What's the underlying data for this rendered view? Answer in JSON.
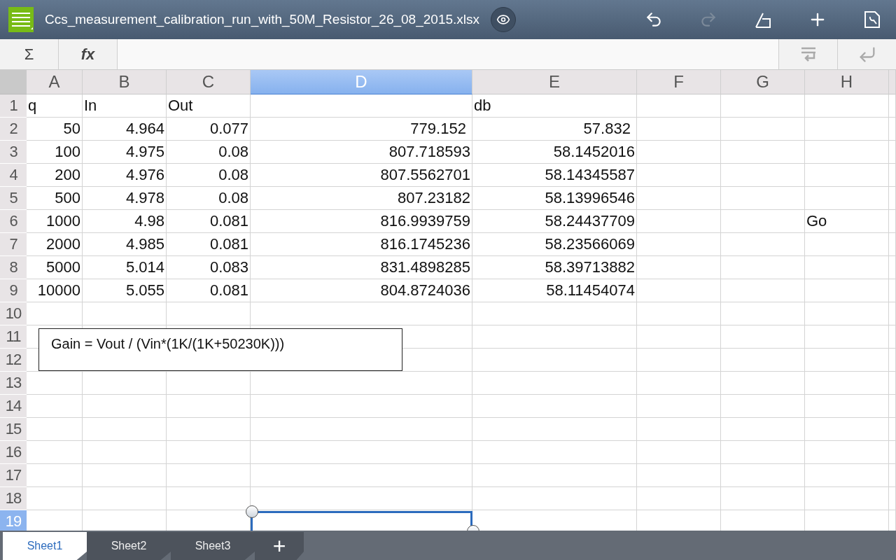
{
  "file_title": "Ccs_measurement_calibration_run_with_50M_Resistor_26_08_2015.xlsx",
  "formula_bar": {
    "sum_label": "Σ",
    "fx_label": "fx"
  },
  "columns": [
    {
      "label": "A",
      "selected": false
    },
    {
      "label": "B",
      "selected": false
    },
    {
      "label": "C",
      "selected": false
    },
    {
      "label": "D",
      "selected": true
    },
    {
      "label": "E",
      "selected": false
    },
    {
      "label": "F",
      "selected": false
    },
    {
      "label": "G",
      "selected": false
    },
    {
      "label": "H",
      "selected": false
    }
  ],
  "rows": [
    {
      "label": "1",
      "selected": false,
      "cells": [
        {
          "kind": "text",
          "value": "q"
        },
        {
          "kind": "text",
          "value": "In"
        },
        {
          "kind": "text",
          "value": "Out"
        },
        {
          "kind": "empty"
        },
        {
          "kind": "text",
          "value": "db"
        }
      ]
    },
    {
      "label": "2",
      "selected": false,
      "cells": [
        {
          "kind": "number",
          "value": "50"
        },
        {
          "kind": "number",
          "value": "4.964"
        },
        {
          "kind": "number",
          "value": "0.077"
        },
        {
          "kind": "number",
          "value": "779.152 "
        },
        {
          "kind": "number",
          "value": "57.832 "
        }
      ]
    },
    {
      "label": "3",
      "selected": false,
      "cells": [
        {
          "kind": "number",
          "value": "100"
        },
        {
          "kind": "number",
          "value": "4.975"
        },
        {
          "kind": "number",
          "value": "0.08"
        },
        {
          "kind": "number",
          "value": "807.718593"
        },
        {
          "kind": "number",
          "value": "58.1452016"
        }
      ]
    },
    {
      "label": "4",
      "selected": false,
      "cells": [
        {
          "kind": "number",
          "value": "200"
        },
        {
          "kind": "number",
          "value": "4.976"
        },
        {
          "kind": "number",
          "value": "0.08"
        },
        {
          "kind": "number",
          "value": "807.5562701"
        },
        {
          "kind": "number",
          "value": "58.14345587"
        }
      ]
    },
    {
      "label": "5",
      "selected": false,
      "cells": [
        {
          "kind": "number",
          "value": "500"
        },
        {
          "kind": "number",
          "value": "4.978"
        },
        {
          "kind": "number",
          "value": "0.08"
        },
        {
          "kind": "number",
          "value": "807.23182"
        },
        {
          "kind": "number",
          "value": "58.13996546"
        }
      ]
    },
    {
      "label": "6",
      "selected": false,
      "cells": [
        {
          "kind": "number",
          "value": "1000"
        },
        {
          "kind": "number",
          "value": "4.98"
        },
        {
          "kind": "number",
          "value": "0.081"
        },
        {
          "kind": "number",
          "value": "816.9939759"
        },
        {
          "kind": "number",
          "value": "58.24437709"
        },
        {
          "kind": "empty"
        },
        {
          "kind": "empty"
        },
        {
          "kind": "text",
          "value": "Go"
        }
      ]
    },
    {
      "label": "7",
      "selected": false,
      "cells": [
        {
          "kind": "number",
          "value": "2000"
        },
        {
          "kind": "number",
          "value": "4.985"
        },
        {
          "kind": "number",
          "value": "0.081"
        },
        {
          "kind": "number",
          "value": "816.1745236"
        },
        {
          "kind": "number",
          "value": "58.23566069"
        }
      ]
    },
    {
      "label": "8",
      "selected": false,
      "cells": [
        {
          "kind": "number",
          "value": "5000"
        },
        {
          "kind": "number",
          "value": "5.014"
        },
        {
          "kind": "number",
          "value": "0.083"
        },
        {
          "kind": "number",
          "value": "831.4898285"
        },
        {
          "kind": "number",
          "value": "58.39713882"
        }
      ]
    },
    {
      "label": "9",
      "selected": false,
      "cells": [
        {
          "kind": "number",
          "value": "10000"
        },
        {
          "kind": "number",
          "value": "5.055"
        },
        {
          "kind": "number",
          "value": "0.081"
        },
        {
          "kind": "number",
          "value": "804.8724036"
        },
        {
          "kind": "number",
          "value": "58.11454074"
        }
      ]
    },
    {
      "label": "10",
      "selected": false,
      "cells": []
    },
    {
      "label": "11",
      "selected": false,
      "cells": []
    },
    {
      "label": "12",
      "selected": false,
      "cells": []
    },
    {
      "label": "13",
      "selected": false,
      "cells": []
    },
    {
      "label": "14",
      "selected": false,
      "cells": []
    },
    {
      "label": "15",
      "selected": false,
      "cells": []
    },
    {
      "label": "16",
      "selected": false,
      "cells": []
    },
    {
      "label": "17",
      "selected": false,
      "cells": []
    },
    {
      "label": "18",
      "selected": false,
      "cells": []
    },
    {
      "label": "19",
      "selected": true,
      "cells": []
    }
  ],
  "text_box": "Gain = Vout / (Vin*(1K/(1K+50230K)))",
  "sheets": [
    {
      "label": "Sheet1",
      "selected": true
    },
    {
      "label": "Sheet2",
      "selected": false
    },
    {
      "label": "Sheet3",
      "selected": false
    }
  ],
  "add_sheet_label": "+"
}
